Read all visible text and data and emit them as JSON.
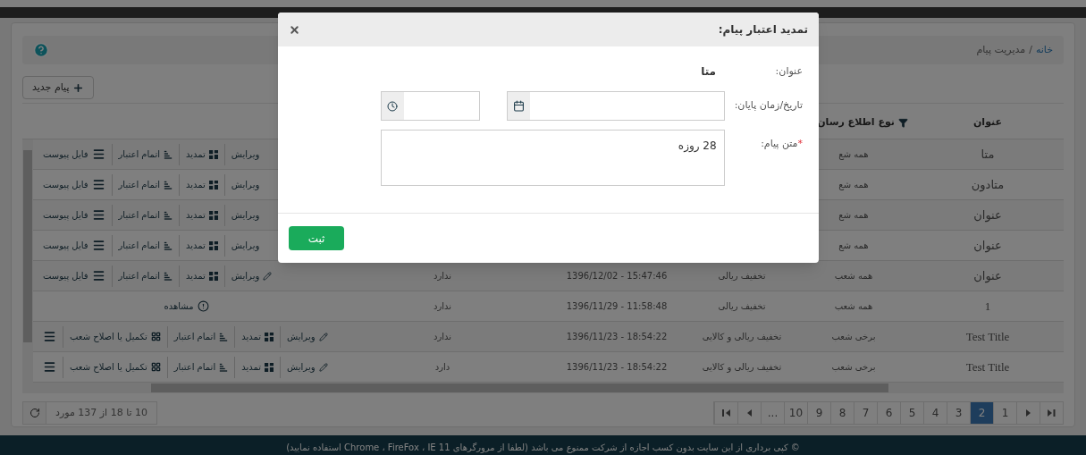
{
  "breadcrumb": {
    "items": [
      {
        "label": "خانه",
        "kind": "link"
      },
      {
        "label": "مدیریت پیام",
        "kind": "current"
      }
    ],
    "separator": "/"
  },
  "new_button": "پیام جدید",
  "table": {
    "columns": [
      {
        "label": "عنوان",
        "filter": false
      },
      {
        "label": "نوع اطلاع رسان",
        "filter": true
      }
    ],
    "rows": [
      {
        "cells": {
          "title": "متا",
          "audience": "همه شع"
        },
        "actions": [
          {
            "kind": "edit_cut",
            "label": "ویرایش"
          },
          {
            "kind": "extend",
            "label": "تمدید"
          },
          {
            "kind": "expire",
            "label": "اتمام اعتبار"
          },
          {
            "kind": "attachment",
            "label": "فایل پیوست"
          }
        ]
      },
      {
        "cells": {
          "title": "متادون",
          "audience": "همه شع"
        },
        "actions": [
          {
            "kind": "edit_cut",
            "label": "ویرایش"
          },
          {
            "kind": "extend",
            "label": "تمدید"
          },
          {
            "kind": "expire",
            "label": "اتمام اعتبار"
          },
          {
            "kind": "attachment",
            "label": "فایل پیوست"
          }
        ]
      },
      {
        "cells": {
          "title": "عنوان",
          "audience": "همه شع"
        },
        "actions": [
          {
            "kind": "edit_cut",
            "label": "ویرایش"
          },
          {
            "kind": "extend",
            "label": "تمدید"
          },
          {
            "kind": "expire",
            "label": "اتمام اعتبار"
          },
          {
            "kind": "attachment",
            "label": "فایل پیوست"
          }
        ]
      },
      {
        "cells": {
          "title": "عنوان",
          "audience": "همه شع"
        },
        "actions": [
          {
            "kind": "edit_cut",
            "label": "ویرایش"
          },
          {
            "kind": "extend",
            "label": "تمدید"
          },
          {
            "kind": "expire",
            "label": "اتمام اعتبار"
          },
          {
            "kind": "attachment",
            "label": "فایل پیوست"
          }
        ]
      },
      {
        "cells": {
          "title": "عنوان",
          "audience": "همه شعب",
          "discount": "تخفیف ریالی",
          "date": "1396/12/02 - 15:47:46",
          "attachment": "ندارد"
        },
        "actions": [
          {
            "kind": "edit",
            "label": "ویرایش"
          },
          {
            "kind": "extend",
            "label": "تمدید"
          },
          {
            "kind": "expire",
            "label": "اتمام اعتبار"
          },
          {
            "kind": "attachment",
            "label": "فایل پیوست"
          }
        ]
      },
      {
        "cells": {
          "title": "1",
          "audience": "همه شعب",
          "discount": "تخفیف ریالی",
          "date": "1396/11/29 - 11:58:48",
          "attachment": "ندارد"
        },
        "actions": [
          {
            "kind": "view",
            "label": "مشاهده"
          }
        ]
      },
      {
        "cells": {
          "title": "Test Title",
          "audience": "برخی شعب",
          "discount": "تخفیف ریالی و کالایی",
          "date": "1396/11/23 - 18:54:22",
          "attachment": "ندارد"
        },
        "actions": [
          {
            "kind": "edit",
            "label": "ویرایش"
          },
          {
            "kind": "extend",
            "label": "تمدید"
          },
          {
            "kind": "expire",
            "label": "اتمام اعتبار"
          },
          {
            "kind": "branches",
            "label": "تکمیل یا اصلاح شعب"
          },
          {
            "kind": "more"
          }
        ]
      },
      {
        "cells": {
          "title": "Test Title",
          "audience": "برخی شعب",
          "discount": "تخفیف ریالی و کالایی",
          "date": "1396/11/23 - 18:54:22",
          "attachment": "دارد"
        },
        "actions": [
          {
            "kind": "edit",
            "label": "ویرایش"
          },
          {
            "kind": "extend",
            "label": "تمدید"
          },
          {
            "kind": "expire",
            "label": "اتمام اعتبار"
          },
          {
            "kind": "branches",
            "label": "تکمیل یا اصلاح شعب"
          },
          {
            "kind": "more"
          }
        ]
      }
    ]
  },
  "pagination": {
    "items": [
      {
        "kind": "last"
      },
      {
        "kind": "next"
      },
      {
        "kind": "page",
        "label": "1",
        "selected": false
      },
      {
        "kind": "page",
        "label": "2",
        "selected": true
      },
      {
        "kind": "page",
        "label": "3",
        "selected": false
      },
      {
        "kind": "page",
        "label": "4",
        "selected": false
      },
      {
        "kind": "page",
        "label": "5",
        "selected": false
      },
      {
        "kind": "page",
        "label": "6",
        "selected": false
      },
      {
        "kind": "page",
        "label": "7",
        "selected": false
      },
      {
        "kind": "page",
        "label": "8",
        "selected": false
      },
      {
        "kind": "page",
        "label": "9",
        "selected": false
      },
      {
        "kind": "page",
        "label": "10",
        "selected": false
      },
      {
        "kind": "page",
        "label": "...",
        "selected": false
      },
      {
        "kind": "prev"
      },
      {
        "kind": "first"
      }
    ],
    "info": "10 تا 18 از 137 مورد"
  },
  "footer": "© کپی برداری از این سایت بدون کسب اجازه از شرکت ممنوع می باشد (لطفا از مرورگرهای Chrome ، FireFox ، IE 11 استفاده نمایید)",
  "modal": {
    "title": "تمدید اعتبار پیام:",
    "subject_label": "عنوان:",
    "subject_value": "متا",
    "end_label": "تاریخ/زمان پایان:",
    "text_label": "متن پیام:",
    "required_mark": "*",
    "text_value": "28 روزه",
    "submit": "ثبت"
  }
}
